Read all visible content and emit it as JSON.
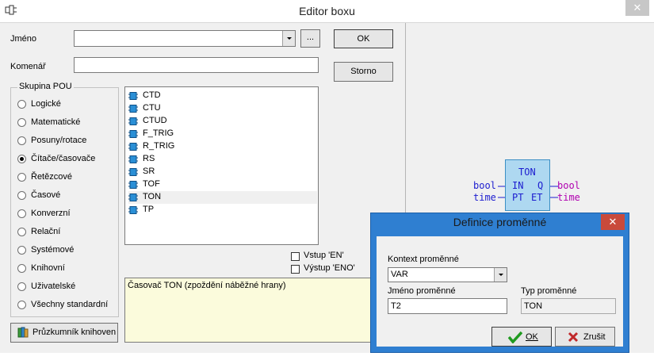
{
  "window": {
    "title": "Editor boxu",
    "close_glyph": "✕"
  },
  "form": {
    "name_label": "Jméno",
    "name_value": "",
    "browse_label": "...",
    "comment_label": "Komenář",
    "comment_value": "",
    "ok_label": "OK",
    "cancel_label": "Storno"
  },
  "pou_group": {
    "title": "Skupina POU",
    "options": [
      {
        "label": "Logické",
        "selected": false
      },
      {
        "label": "Matematické",
        "selected": false
      },
      {
        "label": "Posuny/rotace",
        "selected": false
      },
      {
        "label": "Čítače/časovače",
        "selected": true
      },
      {
        "label": "Řetězcové",
        "selected": false
      },
      {
        "label": "Časové",
        "selected": false
      },
      {
        "label": "Konverzní",
        "selected": false
      },
      {
        "label": "Relační",
        "selected": false
      },
      {
        "label": "Systémové",
        "selected": false
      },
      {
        "label": "Knihovní",
        "selected": false
      },
      {
        "label": "Uživatelské",
        "selected": false
      },
      {
        "label": "Všechny standardní",
        "selected": false
      }
    ]
  },
  "library_button": {
    "label": "Průzkumník knihoven",
    "icon": "library-books-icon"
  },
  "block_list": {
    "icon": "function-block-icon",
    "selected": "TON",
    "items": [
      "CTD",
      "CTU",
      "CTUD",
      "F_TRIG",
      "R_TRIG",
      "RS",
      "SR",
      "TOF",
      "TON",
      "TP"
    ]
  },
  "options": {
    "en_label": "Vstup 'EN'",
    "eno_label": "Výstup 'ENO'"
  },
  "description": "Časovač TON (zpoždění náběžné hrany)",
  "preview": {
    "block_name": "TON",
    "inputs": [
      {
        "type": "bool",
        "pin": "IN"
      },
      {
        "type": "time",
        "pin": "PT"
      }
    ],
    "outputs": [
      {
        "pin": "Q",
        "type": "bool"
      },
      {
        "pin": "ET",
        "type": "time"
      }
    ],
    "colors": {
      "input_type": "#1c1ccf",
      "output_type": "#b000b0",
      "pin": "#1c1ccf",
      "box_fill": "#aed8f1"
    }
  },
  "var_dialog": {
    "title": "Definice proměnné",
    "close_glyph": "✕",
    "context_label": "Kontext proměnné",
    "context_value": "VAR",
    "name_label": "Jméno proměnné",
    "name_value": "T2",
    "type_label": "Typ proměnné",
    "type_value": "TON",
    "ok_label": "OK",
    "cancel_label": "Zrušit"
  }
}
